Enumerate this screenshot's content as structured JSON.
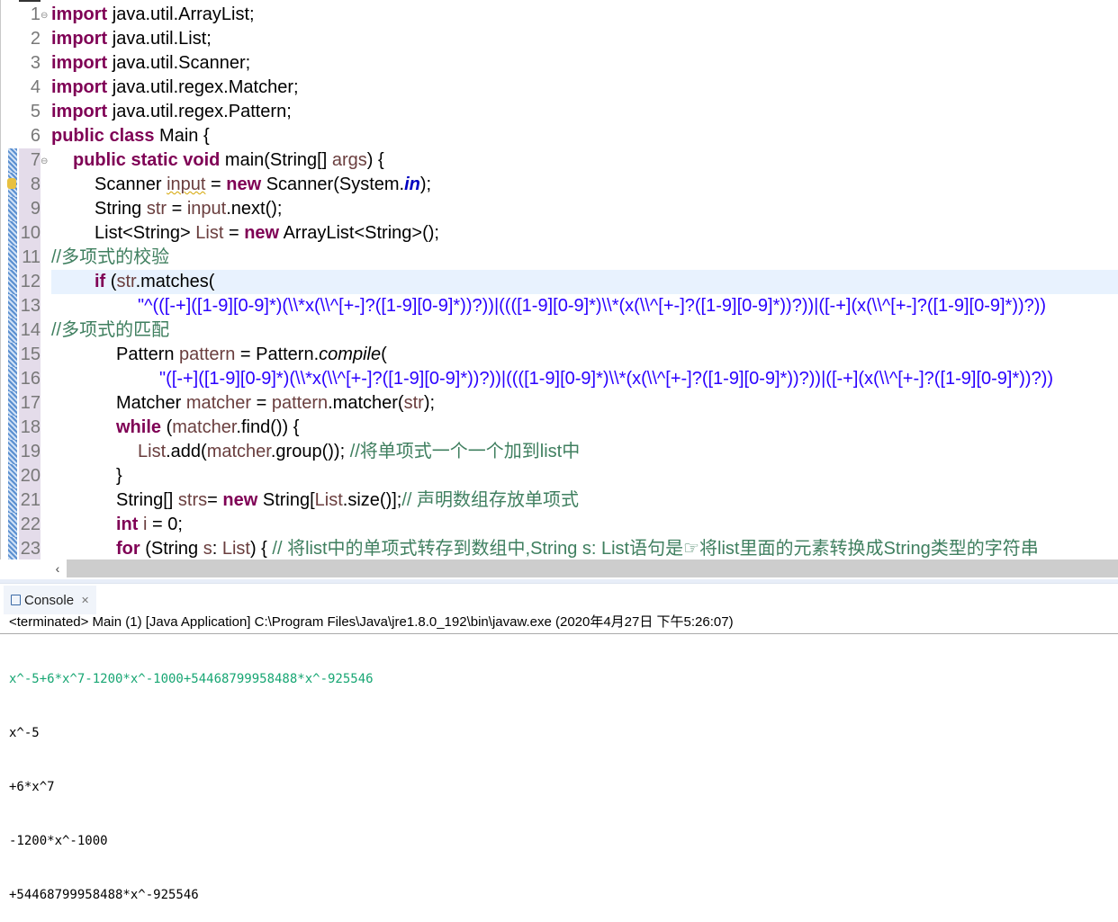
{
  "editor": {
    "current_line": 12,
    "lines": [
      {
        "n": 1,
        "indent": 0,
        "fold": true,
        "t": [
          [
            "kw",
            "import"
          ],
          [
            "id",
            " java.util.ArrayList;"
          ]
        ]
      },
      {
        "n": 2,
        "indent": 0,
        "t": [
          [
            "kw",
            "import"
          ],
          [
            "id",
            " java.util.List;"
          ]
        ]
      },
      {
        "n": 3,
        "indent": 0,
        "t": [
          [
            "kw",
            "import"
          ],
          [
            "id",
            " java.util.Scanner;"
          ]
        ]
      },
      {
        "n": 4,
        "indent": 0,
        "t": [
          [
            "kw",
            "import"
          ],
          [
            "id",
            " java.util.regex.Matcher;"
          ]
        ]
      },
      {
        "n": 5,
        "indent": 0,
        "t": [
          [
            "kw",
            "import"
          ],
          [
            "id",
            " java.util.regex.Pattern;"
          ]
        ]
      },
      {
        "n": 6,
        "indent": 0,
        "t": [
          [
            "kw",
            "public class"
          ],
          [
            "id",
            " Main {"
          ]
        ]
      },
      {
        "n": 7,
        "indent": 1,
        "fold": true,
        "t": [
          [
            "kw",
            "public static void"
          ],
          [
            "id",
            " main(String[] "
          ],
          [
            "var",
            "args"
          ],
          [
            "id",
            ") {"
          ]
        ]
      },
      {
        "n": 8,
        "indent": 2,
        "warning": true,
        "t": [
          [
            "id",
            "Scanner "
          ],
          [
            "var sq",
            "input"
          ],
          [
            "id",
            " = "
          ],
          [
            "kw",
            "new"
          ],
          [
            "id",
            " Scanner(System."
          ],
          [
            "fld",
            "in"
          ],
          [
            "id",
            ");"
          ]
        ]
      },
      {
        "n": 9,
        "indent": 2,
        "t": [
          [
            "id",
            "String "
          ],
          [
            "var",
            "str"
          ],
          [
            "id",
            " = "
          ],
          [
            "var",
            "input"
          ],
          [
            "id",
            ".next();"
          ]
        ]
      },
      {
        "n": 10,
        "indent": 2,
        "t": [
          [
            "id",
            "List<String> "
          ],
          [
            "var",
            "List"
          ],
          [
            "id",
            " = "
          ],
          [
            "kw",
            "new"
          ],
          [
            "id",
            " ArrayList<String>();"
          ]
        ]
      },
      {
        "n": 11,
        "indent": 0,
        "t": [
          [
            "cm",
            "//多项式的校验"
          ]
        ]
      },
      {
        "n": 12,
        "indent": 2,
        "t": [
          [
            "kw",
            "if"
          ],
          [
            "id",
            " ("
          ],
          [
            "var",
            "str"
          ],
          [
            "id",
            ".matches("
          ]
        ]
      },
      {
        "n": 13,
        "indent": 4,
        "t": [
          [
            "str",
            "\"^(([-+]([1-9][0-9]*)(\\\\*x(\\\\^[+-]?([1-9][0-9]*))?))|((([1-9][0-9]*)\\\\*(x(\\\\^[+-]?([1-9][0-9]*))?))|([-+](x(\\\\^[+-]?([1-9][0-9]*))?))"
          ]
        ]
      },
      {
        "n": 14,
        "indent": 0,
        "t": [
          [
            "cm",
            "//多项式的匹配"
          ]
        ]
      },
      {
        "n": 15,
        "indent": 3,
        "t": [
          [
            "id",
            "Pattern "
          ],
          [
            "var",
            "pattern"
          ],
          [
            "id",
            " = Pattern."
          ],
          [
            "it",
            "compile"
          ],
          [
            "id",
            "("
          ]
        ]
      },
      {
        "n": 16,
        "indent": 5,
        "t": [
          [
            "str",
            "\"([-+]([1-9][0-9]*)(\\\\*x(\\\\^[+-]?([1-9][0-9]*))?))|((([1-9][0-9]*)\\\\*(x(\\\\^[+-]?([1-9][0-9]*))?))|([-+](x(\\\\^[+-]?([1-9][0-9]*))?))"
          ]
        ]
      },
      {
        "n": 17,
        "indent": 3,
        "t": [
          [
            "id",
            "Matcher "
          ],
          [
            "var",
            "matcher"
          ],
          [
            "id",
            " = "
          ],
          [
            "var",
            "pattern"
          ],
          [
            "id",
            ".matcher("
          ],
          [
            "var",
            "str"
          ],
          [
            "id",
            ");"
          ]
        ]
      },
      {
        "n": 18,
        "indent": 3,
        "t": [
          [
            "kw",
            "while"
          ],
          [
            "id",
            " ("
          ],
          [
            "var",
            "matcher"
          ],
          [
            "id",
            ".find()) {"
          ]
        ]
      },
      {
        "n": 19,
        "indent": 4,
        "t": [
          [
            "var",
            "List"
          ],
          [
            "id",
            ".add("
          ],
          [
            "var",
            "matcher"
          ],
          [
            "id",
            ".group()); "
          ],
          [
            "cm",
            "//将单项式一个一个加到list中"
          ]
        ]
      },
      {
        "n": 20,
        "indent": 3,
        "t": [
          [
            "id",
            "}"
          ]
        ]
      },
      {
        "n": 21,
        "indent": 3,
        "t": [
          [
            "id",
            "String[] "
          ],
          [
            "var",
            "strs"
          ],
          [
            "id",
            "= "
          ],
          [
            "kw",
            "new"
          ],
          [
            "id",
            " String["
          ],
          [
            "var",
            "List"
          ],
          [
            "id",
            ".size()];"
          ],
          [
            "cm",
            "// 声明数组存放单项式"
          ]
        ]
      },
      {
        "n": 22,
        "indent": 3,
        "t": [
          [
            "kw",
            "int"
          ],
          [
            "id",
            " "
          ],
          [
            "var",
            "i"
          ],
          [
            "id",
            " = 0;"
          ]
        ]
      },
      {
        "n": 23,
        "indent": 3,
        "t": [
          [
            "kw",
            "for"
          ],
          [
            "id",
            " (String "
          ],
          [
            "var",
            "s"
          ],
          [
            "id",
            ": "
          ],
          [
            "var",
            "List"
          ],
          [
            "id",
            ") { "
          ],
          [
            "cm",
            "// 将list中的单项式转存到数组中,String s: List语句是☞将list里面的元素转换成String类型的字符串"
          ]
        ]
      }
    ]
  },
  "scrollbar": {
    "left_arrow": "‹"
  },
  "console": {
    "tab_label": "Console",
    "close_glyph": "✕",
    "header": "<terminated> Main (1) [Java Application] C:\\Program Files\\Java\\jre1.8.0_192\\bin\\javaw.exe (2020年4月27日 下午5:26:07)",
    "input_line": "x^-5+6*x^7-1200*x^-1000+54468799958488*x^-925546",
    "output_lines": [
      "x^-5",
      "+6*x^7",
      "-1200*x^-1000",
      "+54468799958488*x^-925546"
    ]
  },
  "colors": {
    "keyword": "#7f0055",
    "string": "#2a00ff",
    "comment": "#3f7f5f",
    "variable": "#6a3e3e",
    "stdin": "#17a673",
    "current_line": "#e8f2fe"
  }
}
